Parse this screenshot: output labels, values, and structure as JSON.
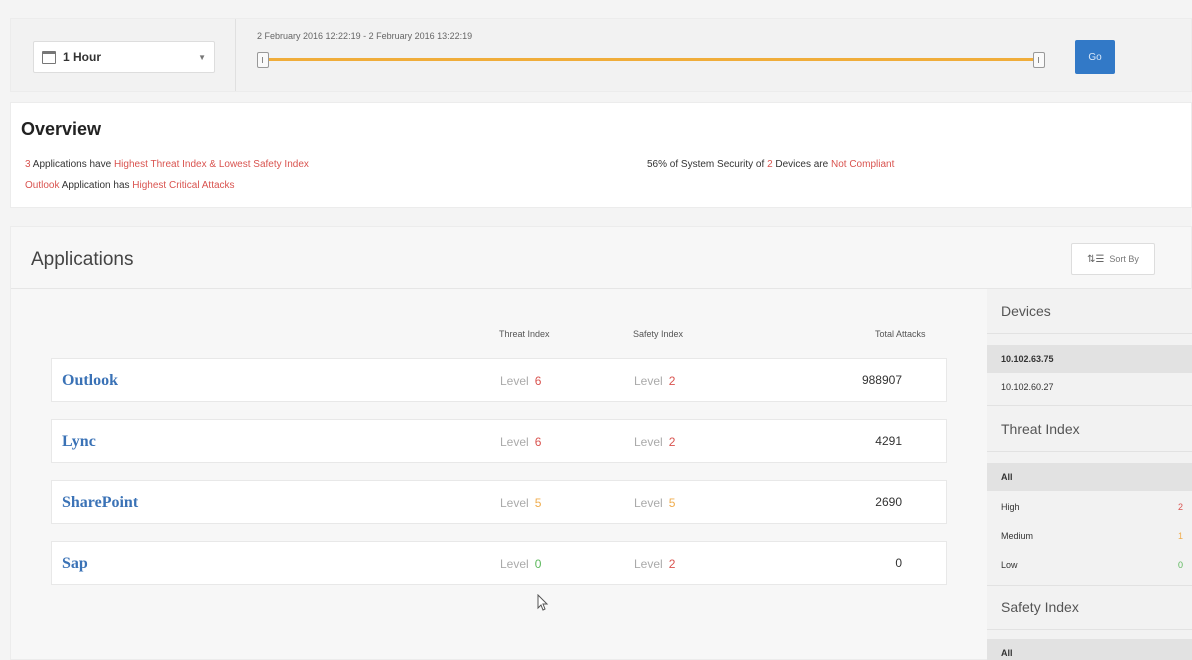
{
  "timebar": {
    "range_select": "1 Hour",
    "range_text": "2 February 2016 12:22:19 - 2 February 2016 13:22:19",
    "go_label": "Go",
    "accent": "#f0ad3a",
    "button_color": "#3279c7"
  },
  "overview": {
    "title": "Overview",
    "line1": {
      "count": "3",
      "mid": " Applications have ",
      "highlight": "Highest Threat Index & Lowest Safety Index"
    },
    "line2": {
      "app": "Outlook",
      "mid": " Application has ",
      "highlight": "Highest Critical Attacks"
    },
    "line3": {
      "pre": "56% of System Security of ",
      "count": "2",
      "mid": " Devices are ",
      "highlight": "Not Compliant"
    }
  },
  "applications": {
    "title": "Applications",
    "sort_label": "Sort By",
    "columns": {
      "threat": "Threat Index",
      "safety": "Safety Index",
      "total": "Total Attacks"
    },
    "level_word": "Level",
    "rows": [
      {
        "name": "Outlook",
        "threat": "6",
        "threat_color": "#d9534f",
        "safety": "2",
        "safety_color": "#d9534f",
        "total": "988907"
      },
      {
        "name": "Lync",
        "threat": "6",
        "threat_color": "#d9534f",
        "safety": "2",
        "safety_color": "#d9534f",
        "total": "4291"
      },
      {
        "name": "SharePoint",
        "threat": "5",
        "threat_color": "#f0ad4e",
        "safety": "5",
        "safety_color": "#f0ad4e",
        "total": "2690"
      },
      {
        "name": "Sap",
        "threat": "0",
        "threat_color": "#5cb85c",
        "safety": "2",
        "safety_color": "#d9534f",
        "total": "0"
      }
    ]
  },
  "sidebar": {
    "devices_title": "Devices",
    "devices": [
      "10.102.63.75",
      "10.102.60.27"
    ],
    "threat_title": "Threat Index",
    "threat_items": [
      {
        "label": "All",
        "count": ""
      },
      {
        "label": "High",
        "count": "2"
      },
      {
        "label": "Medium",
        "count": "1"
      },
      {
        "label": "Low",
        "count": "0"
      }
    ],
    "safety_title": "Safety Index",
    "safety_items": [
      {
        "label": "All"
      }
    ]
  }
}
